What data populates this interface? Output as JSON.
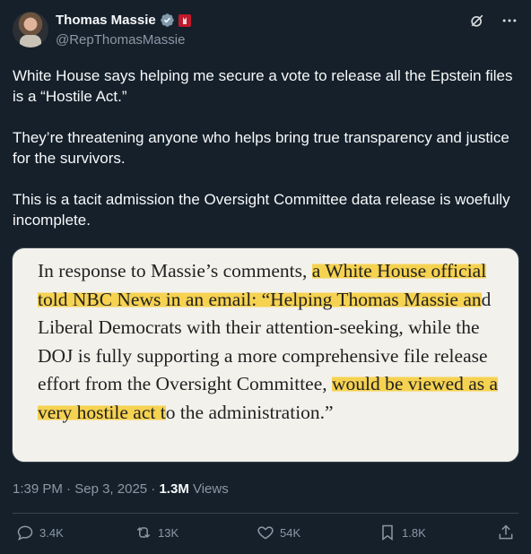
{
  "author": {
    "name": "Thomas Massie",
    "handle": "@RepThomasMassie"
  },
  "tweet": {
    "text": "White House says helping me secure a vote to release all the Epstein files is a “Hostile Act.”\n\nThey’re threatening anyone who helps bring true transparency and justice for the survivors.\n\nThis is a tacit admission the Oversight Committee data release is woefully incomplete."
  },
  "quote_image": {
    "segments": [
      {
        "text": "In response to Massie’s comments, ",
        "highlight": false
      },
      {
        "text": "a White House official told NBC News in an email: “Helping Thomas Massie an",
        "highlight": true
      },
      {
        "text": "d Liberal Democrats with their attention-seeking, while the DOJ is fully supporting a more comprehensive file release effort from the Oversight Committee, ",
        "highlight": false
      },
      {
        "text": "would be viewed as a very hostile act t",
        "highlight": true
      },
      {
        "text": "o the administration.”",
        "highlight": false
      }
    ],
    "highlight_color": "#f6d251"
  },
  "meta": {
    "time": "1:39 PM",
    "sep1": " · ",
    "date": "Sep 3, 2025",
    "sep2": " · ",
    "views_count": "1.3M",
    "views_label": " Views"
  },
  "actions": {
    "replies": "3.4K",
    "reposts": "13K",
    "likes": "54K",
    "bookmarks": "1.8K"
  },
  "icons": [
    "verified-badge-icon",
    "flag-icon",
    "grok-icon",
    "more-icon",
    "reply-icon",
    "repost-icon",
    "like-icon",
    "bookmark-icon",
    "share-icon"
  ],
  "colors": {
    "background": "#15202b",
    "text": "#f7f9f9",
    "muted": "#8b98a5",
    "verified": "#829aab"
  }
}
